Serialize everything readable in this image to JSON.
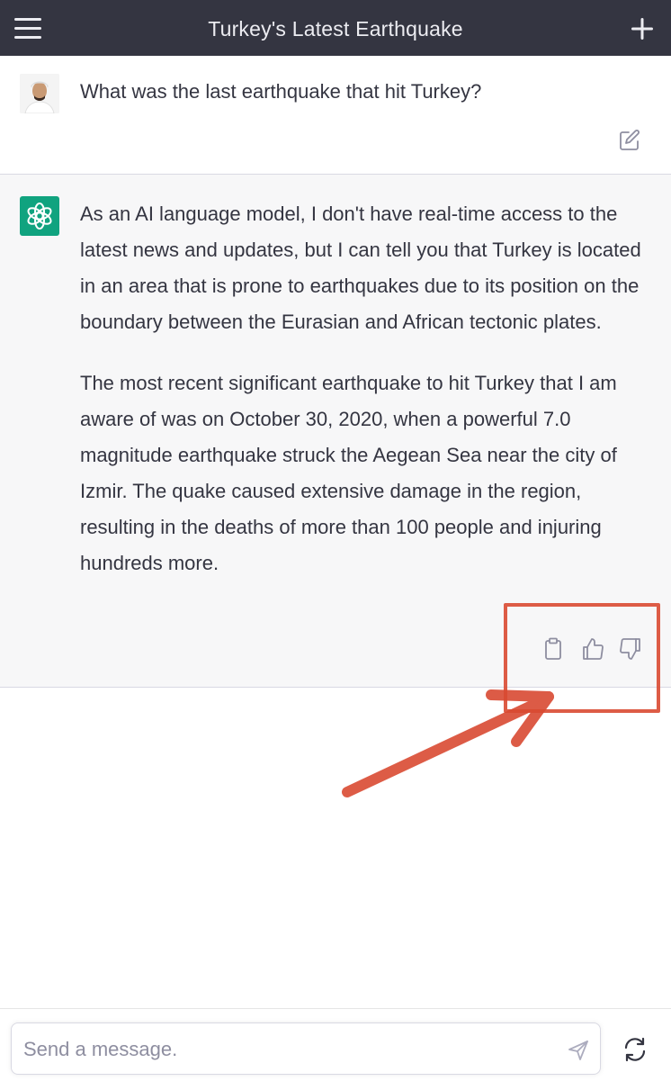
{
  "header": {
    "title": "Turkey's Latest Earthquake",
    "menu_icon": "hamburger-menu-icon",
    "new_chat_icon": "plus-icon"
  },
  "conversation": {
    "user_message": "What was the last earthquake that hit Turkey?",
    "assistant_paragraphs": [
      "As an AI language model, I don't have real-time access to the latest news and updates, but I can tell you that Turkey is located in an area that is prone to earthquakes due to its position on the boundary between the Eurasian and African tectonic plates.",
      "The most recent significant earthquake to hit Turkey that I am aware of was on October 30, 2020, when a powerful 7.0 magnitude earthquake struck the Aegean Sea near the city of Izmir. The quake caused extensive damage in the region, resulting in the deaths of more than 100 people and injuring hundreds more."
    ],
    "action_icons": [
      "clipboard-icon",
      "thumbs-up-icon",
      "thumbs-down-icon"
    ]
  },
  "composer": {
    "placeholder": "Send a message.",
    "send_icon": "send-icon",
    "regenerate_icon": "regenerate-icon"
  },
  "colors": {
    "header_bg": "#343541",
    "assistant_bg": "#f7f7f8",
    "bot_avatar": "#10a37f",
    "annotation": "#d94a32"
  }
}
